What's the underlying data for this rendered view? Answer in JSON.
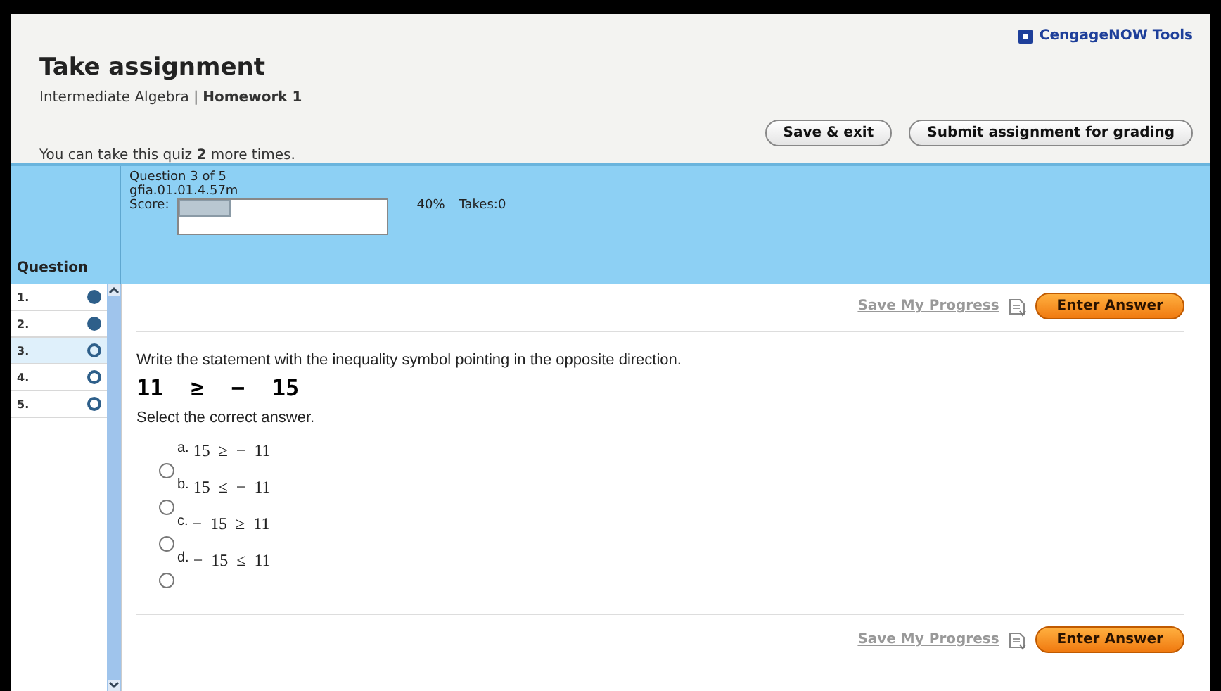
{
  "header": {
    "title": "Take assignment",
    "breadcrumb": "Intermediate Algebra | **Homework 1**",
    "tools_link": "CengageNOW Tools",
    "attempts_note": "You can take this quiz **2** more times.",
    "buttons": [
      "Save & exit",
      "Submit assignment for grading"
    ]
  },
  "info_bar": {
    "column_label": "Question",
    "question_of": "Question 3 of 5",
    "question_id": "gfia.01.01.4.57m",
    "score_label": "Score:",
    "score": {
      "level": 0.25
    },
    "score_reading": "40%",
    "takes": "Takes:0"
  },
  "questions": [
    {
      "number": "1.",
      "answered": true,
      "selected": false
    },
    {
      "number": "2.",
      "answered": true,
      "selected": false
    },
    {
      "number": "3.",
      "answered": false,
      "selected": true
    },
    {
      "number": "4.",
      "answered": false,
      "selected": false
    },
    {
      "number": "5.",
      "answered": false,
      "selected": false
    }
  ],
  "top_actions": {
    "save_link": "Save My Progress",
    "enter_button": "Enter Answer"
  },
  "problem": {
    "instruction": "Write the statement with the inequality symbol pointing in the opposite direction.",
    "expression": "11  ≥  −  15",
    "prompt": "Select the correct answer."
  },
  "options": [
    {
      "letter": "a.",
      "text": "15  ≥  −  11",
      "selected": false
    },
    {
      "letter": "b.",
      "text": "15  ≤  −  11",
      "selected": false
    },
    {
      "letter": "c.",
      "text": "−  15  ≥  11",
      "selected": false
    },
    {
      "letter": "d.",
      "text": "−  15  ≤  11",
      "selected": false
    }
  ],
  "bottom_actions": {
    "save_link": "Save My Progress",
    "enter_button": "Enter Answer"
  }
}
